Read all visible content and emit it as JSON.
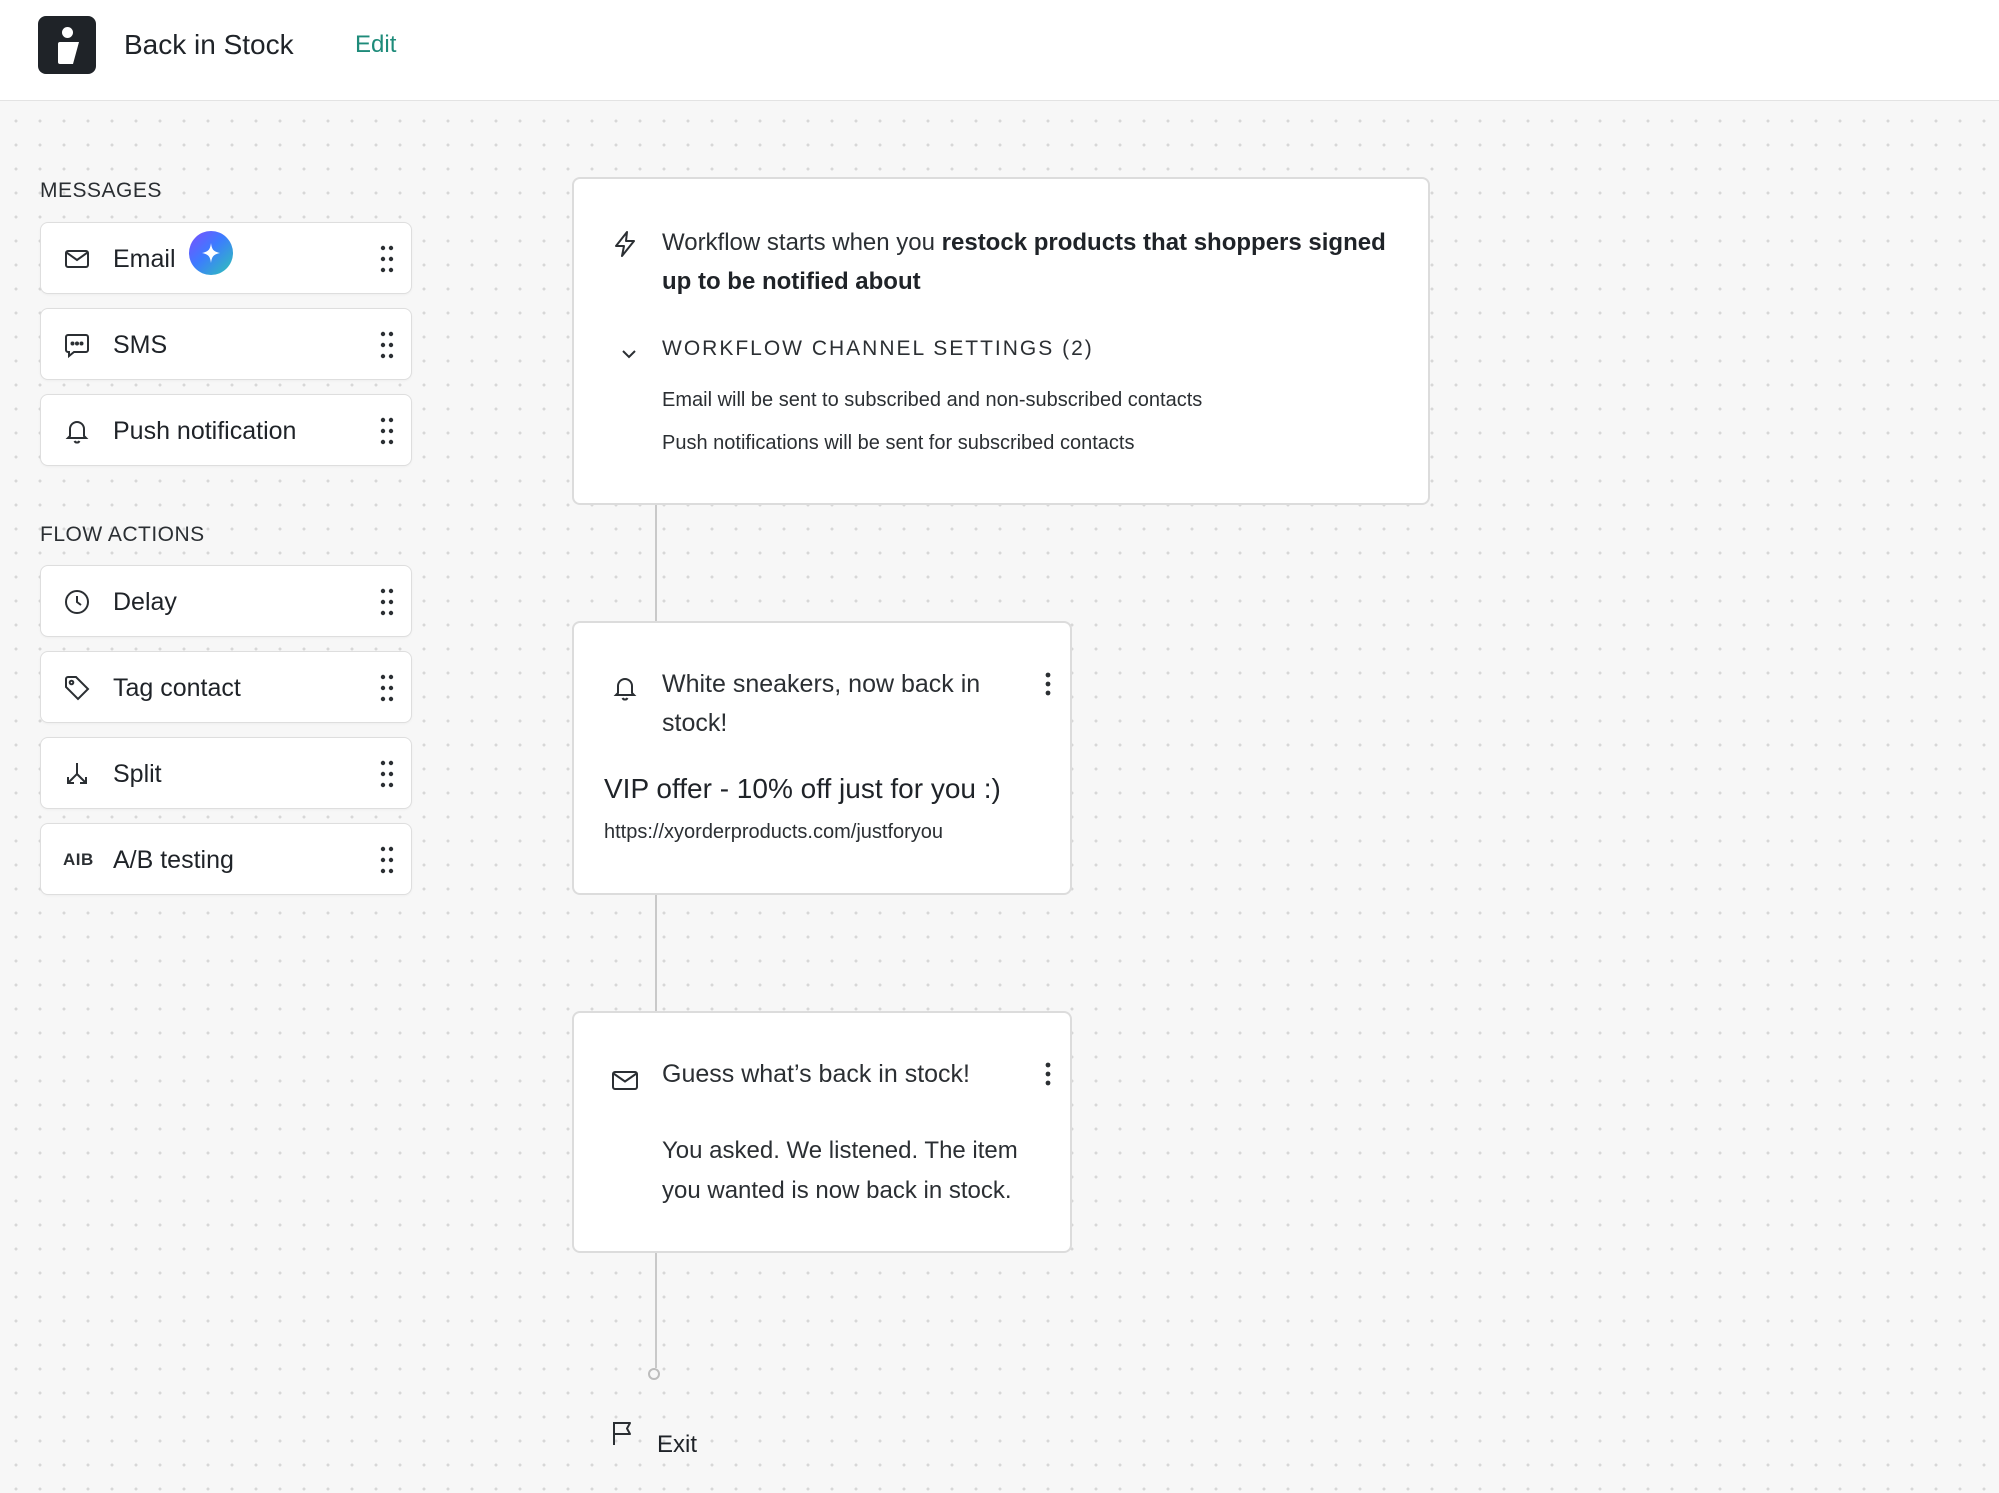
{
  "header": {
    "logo_icon": "info-i-icon",
    "title": "Back in Stock",
    "edit_label": "Edit"
  },
  "sidebar": {
    "messages_heading": "MESSAGES",
    "messages": [
      {
        "label": "Email",
        "icon": "mail-icon",
        "badge": "ai-sparkle-icon"
      },
      {
        "label": "SMS",
        "icon": "chat-bubble-icon"
      },
      {
        "label": "Push notification",
        "icon": "bell-icon"
      }
    ],
    "actions_heading": "FLOW ACTIONS",
    "actions": [
      {
        "label": "Delay",
        "icon": "clock-icon"
      },
      {
        "label": "Tag contact",
        "icon": "tag-icon"
      },
      {
        "label": "Split",
        "icon": "split-icon"
      },
      {
        "label": "A/B testing",
        "icon": "ab-icon",
        "icon_text": "AIB"
      }
    ]
  },
  "trigger": {
    "icon": "lightning-icon",
    "text_prefix": "Workflow starts when you ",
    "text_bold": "restock products that shoppers signed up to be notified about",
    "settings_title": "WORKFLOW CHANNEL SETTINGS (2)",
    "settings_lines": [
      "Email will be sent to subscribed and non-subscribed contacts",
      "Push notifications will be sent for subscribed contacts"
    ]
  },
  "push_step": {
    "icon": "bell-icon",
    "title": "White sneakers, now back in stock!",
    "body_title": "VIP offer - 10% off just for you :)",
    "url": "https://xyorderproducts.com/justforyou"
  },
  "email_step": {
    "icon": "mail-icon",
    "title": "Guess what’s back in stock!",
    "body": "You asked. We listened. The item you wanted is now back in stock."
  },
  "exit": {
    "icon": "flag-icon",
    "label": "Exit"
  },
  "colors": {
    "accent": "#1e8b7a",
    "logo_bg": "#1f2328",
    "canvas_bg": "#f7f7f7",
    "node_border": "#dcdcdc"
  }
}
